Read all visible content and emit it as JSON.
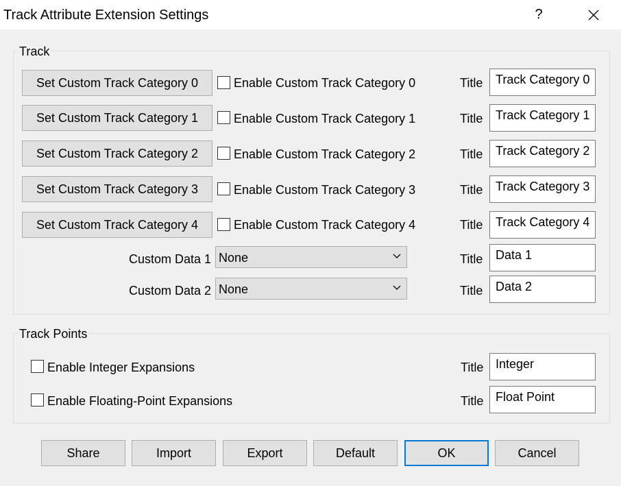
{
  "window": {
    "title": "Track Attribute Extension Settings",
    "help_label": "?",
    "close_icon": "close-icon"
  },
  "track_group": {
    "legend": "Track",
    "categories": [
      {
        "set_label": "Set Custom Track Category 0",
        "enable_label": "Enable Custom Track Category 0",
        "title_label": "Title",
        "title_value": "Track Category  0"
      },
      {
        "set_label": "Set Custom Track Category 1",
        "enable_label": "Enable Custom Track Category 1",
        "title_label": "Title",
        "title_value": "Track Category  1"
      },
      {
        "set_label": "Set Custom Track Category 2",
        "enable_label": "Enable Custom Track Category 2",
        "title_label": "Title",
        "title_value": "Track Category  2"
      },
      {
        "set_label": "Set Custom Track Category 3",
        "enable_label": "Enable Custom Track Category 3",
        "title_label": "Title",
        "title_value": "Track Category  3"
      },
      {
        "set_label": "Set Custom Track Category 4",
        "enable_label": "Enable Custom Track Category 4",
        "title_label": "Title",
        "title_value": "Track Category  4"
      }
    ],
    "custom_data": [
      {
        "label": "Custom Data 1",
        "selected": "None",
        "title_label": "Title",
        "title_value": "Data 1"
      },
      {
        "label": "Custom Data 2",
        "selected": "None",
        "title_label": "Title",
        "title_value": "Data 2"
      }
    ]
  },
  "points_group": {
    "legend": "Track Points",
    "integer": {
      "label": "Enable Integer Expansions",
      "title_label": "Title",
      "title_value": "Integer"
    },
    "float": {
      "label": "Enable Floating-Point Expansions",
      "title_label": "Title",
      "title_value": "Float Point"
    }
  },
  "buttons": {
    "share": "Share",
    "import": "Import",
    "export": "Export",
    "default": "Default",
    "ok": "OK",
    "cancel": "Cancel"
  },
  "colors": {
    "accent": "#0078d7",
    "background": "#f0f0f0",
    "titlebar": "#ffffff"
  }
}
